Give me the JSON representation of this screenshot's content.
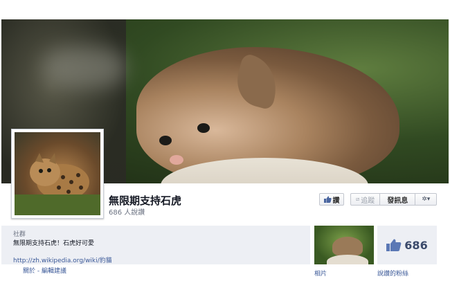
{
  "page": {
    "name": "無限期支持石虎",
    "likes_line": "686 人說讚"
  },
  "actions": {
    "like_label": "讚",
    "follow_label": "追蹤",
    "message_label": "發訊息",
    "gear_symbol": "✲▾"
  },
  "about": {
    "category": "社群",
    "description": "無限期支持石虎！石虎好可愛",
    "link": "http://zh.wikipedia.org/wiki/豹貓",
    "footer": "關於 - 編輯建議"
  },
  "tiles": {
    "photos_label": "相片",
    "likes_count": "686",
    "likes_label": "說讚的粉絲"
  },
  "colors": {
    "link": "#3b5998",
    "box_bg": "#edeff4",
    "like_icon": "#4a66a0"
  }
}
